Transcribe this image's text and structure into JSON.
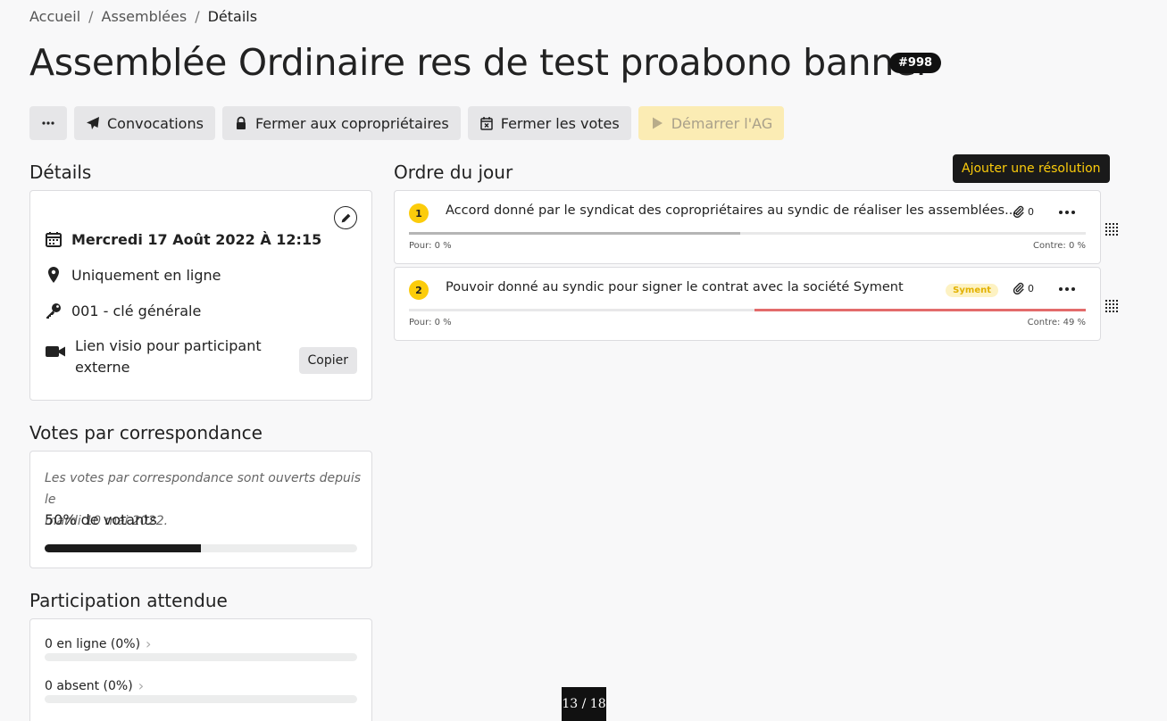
{
  "breadcrumb": {
    "home": "Accueil",
    "list": "Assemblées",
    "current": "Détails",
    "sep": "/"
  },
  "page": {
    "title": "Assemblée Ordinaire res de test proabono banner",
    "id_badge": "#998"
  },
  "toolbar": {
    "more_icon": "ellipsis-icon",
    "convocations": "Convocations",
    "close_owners": "Fermer aux copropriétaires",
    "close_votes": "Fermer les votes",
    "start_ag": "Démarrer l'AG"
  },
  "details": {
    "title": "Détails",
    "date": "Mercredi 17 Août 2022 À 12:15",
    "location": "Uniquement en ligne",
    "key": "001 - clé générale",
    "visio_line1": "Lien visio pour participant",
    "visio_line2": "externe",
    "copy": "Copier"
  },
  "correspondance": {
    "title": "Votes par correspondance",
    "line1": "Les votes par correspondance sont ouverts depuis le",
    "line2": "mardi 10 mai 2022.",
    "voters": "50% de votants",
    "progress_fraction": 0.5
  },
  "participation": {
    "title": "Participation attendue",
    "rows": [
      {
        "label": "0 en ligne (0%)",
        "fraction": 0
      },
      {
        "label": "0 absent (0%)",
        "fraction": 0
      }
    ]
  },
  "agenda": {
    "title": "Ordre du jour",
    "add_button": "Ajouter une résolution",
    "items": [
      {
        "number": "1",
        "text": "Accord donné par le syndicat des copropriétaires au syndic de réaliser les assemblées...",
        "attachments": "0",
        "tag": "",
        "pour_label": "Pour: 0 %",
        "contre_label": "Contre: 0 %",
        "pour_fraction": 0.49,
        "contre_fraction": 0
      },
      {
        "number": "2",
        "text": "Pouvoir donné au syndic pour signer le contrat avec la société Syment",
        "attachments": "0",
        "tag": "Syment",
        "pour_label": "Pour: 0 %",
        "contre_label": "Contre: 49 %",
        "pour_fraction": 0,
        "contre_fraction": 0.49
      }
    ]
  },
  "pager": {
    "text": "13 / 18"
  },
  "colors": {
    "accent": "#fccc0b",
    "dark": "#1a1a1a",
    "contre": "#e36b6b"
  }
}
